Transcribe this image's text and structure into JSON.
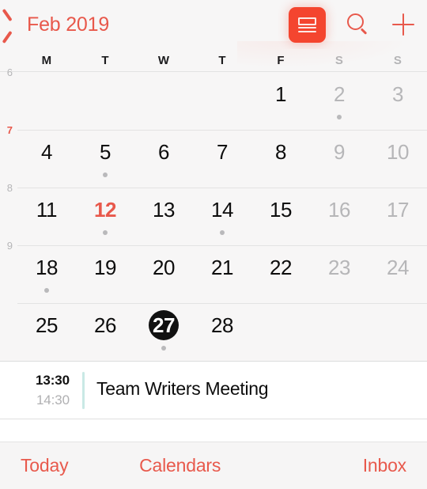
{
  "navbar": {
    "back_label": "Feb 2019",
    "back_icon": "chevron-left-icon",
    "view_toggle_icon": "day-view-icon",
    "search_icon": "search-icon",
    "add_icon": "plus-icon"
  },
  "weekdays": [
    {
      "label": "M",
      "weekend": false
    },
    {
      "label": "T",
      "weekend": false
    },
    {
      "label": "W",
      "weekend": false
    },
    {
      "label": "T",
      "weekend": false
    },
    {
      "label": "F",
      "weekend": false
    },
    {
      "label": "S",
      "weekend": true
    },
    {
      "label": "S",
      "weekend": true
    }
  ],
  "calendar": {
    "month": "Feb",
    "year": "2019",
    "today": 12,
    "selected": 27,
    "accent_color": "#e8584b",
    "selected_bg": "#111111",
    "weeks": [
      {
        "number": "6",
        "current": false,
        "days": [
          {
            "label": "",
            "empty": true,
            "dim": false,
            "dot": false
          },
          {
            "label": "",
            "empty": true,
            "dim": false,
            "dot": false
          },
          {
            "label": "",
            "empty": true,
            "dim": false,
            "dot": false
          },
          {
            "label": "",
            "empty": true,
            "dim": false,
            "dot": false
          },
          {
            "label": "1",
            "empty": false,
            "dim": false,
            "dot": false
          },
          {
            "label": "2",
            "empty": false,
            "dim": true,
            "dot": true
          },
          {
            "label": "3",
            "empty": false,
            "dim": true,
            "dot": false
          }
        ]
      },
      {
        "number": "7",
        "current": true,
        "days": [
          {
            "label": "4",
            "empty": false,
            "dim": false,
            "dot": false
          },
          {
            "label": "5",
            "empty": false,
            "dim": false,
            "dot": true
          },
          {
            "label": "6",
            "empty": false,
            "dim": false,
            "dot": false
          },
          {
            "label": "7",
            "empty": false,
            "dim": false,
            "dot": false
          },
          {
            "label": "8",
            "empty": false,
            "dim": false,
            "dot": false
          },
          {
            "label": "9",
            "empty": false,
            "dim": true,
            "dot": false
          },
          {
            "label": "10",
            "empty": false,
            "dim": true,
            "dot": false
          }
        ]
      },
      {
        "number": "8",
        "current": false,
        "days": [
          {
            "label": "11",
            "empty": false,
            "dim": false,
            "dot": false
          },
          {
            "label": "12",
            "empty": false,
            "dim": false,
            "dot": true,
            "today": true
          },
          {
            "label": "13",
            "empty": false,
            "dim": false,
            "dot": false
          },
          {
            "label": "14",
            "empty": false,
            "dim": false,
            "dot": true
          },
          {
            "label": "15",
            "empty": false,
            "dim": false,
            "dot": false
          },
          {
            "label": "16",
            "empty": false,
            "dim": true,
            "dot": false
          },
          {
            "label": "17",
            "empty": false,
            "dim": true,
            "dot": false
          }
        ]
      },
      {
        "number": "9",
        "current": false,
        "days": [
          {
            "label": "18",
            "empty": false,
            "dim": false,
            "dot": true
          },
          {
            "label": "19",
            "empty": false,
            "dim": false,
            "dot": false
          },
          {
            "label": "20",
            "empty": false,
            "dim": false,
            "dot": false
          },
          {
            "label": "21",
            "empty": false,
            "dim": false,
            "dot": false
          },
          {
            "label": "22",
            "empty": false,
            "dim": false,
            "dot": false
          },
          {
            "label": "23",
            "empty": false,
            "dim": true,
            "dot": false
          },
          {
            "label": "24",
            "empty": false,
            "dim": true,
            "dot": false
          }
        ]
      },
      {
        "number": "",
        "current": false,
        "days": [
          {
            "label": "25",
            "empty": false,
            "dim": false,
            "dot": false
          },
          {
            "label": "26",
            "empty": false,
            "dim": false,
            "dot": false
          },
          {
            "label": "27",
            "empty": false,
            "dim": false,
            "dot": true,
            "selected": true
          },
          {
            "label": "28",
            "empty": false,
            "dim": false,
            "dot": false
          },
          {
            "label": "",
            "empty": true,
            "dim": false,
            "dot": false
          },
          {
            "label": "",
            "empty": true,
            "dim": false,
            "dot": false
          },
          {
            "label": "",
            "empty": true,
            "dim": false,
            "dot": false
          }
        ]
      }
    ]
  },
  "events": [
    {
      "start_time": "13:30",
      "end_time": "14:30",
      "title": "Team Writers Meeting",
      "bar_color": "#c9e9e5"
    }
  ],
  "toolbar": {
    "today_label": "Today",
    "calendars_label": "Calendars",
    "inbox_label": "Inbox"
  }
}
